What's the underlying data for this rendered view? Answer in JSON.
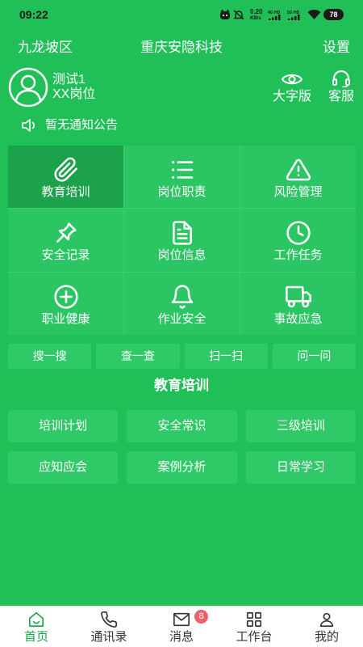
{
  "status_bar": {
    "time": "09:22",
    "net_speed": "0.20",
    "net_unit": "KB/s",
    "net_4g": "4G HD",
    "net_5g": "5G HD",
    "battery": "78"
  },
  "header": {
    "district": "九龙坡区",
    "company": "重庆安隐科技",
    "settings": "设置"
  },
  "user": {
    "name": "测试1",
    "position": "XX岗位"
  },
  "header_actions": {
    "large_font": "大字版",
    "service": "客服"
  },
  "notice": {
    "text": "暂无通知公告"
  },
  "grid": [
    {
      "label": "教育培训",
      "icon": "paperclip-icon",
      "selected": true
    },
    {
      "label": "岗位职责",
      "icon": "list-icon"
    },
    {
      "label": "风险管理",
      "icon": "warning-icon"
    },
    {
      "label": "安全记录",
      "icon": "pin-icon"
    },
    {
      "label": "岗位信息",
      "icon": "document-icon"
    },
    {
      "label": "工作任务",
      "icon": "clock-icon"
    },
    {
      "label": "职业健康",
      "icon": "plus-circle-icon"
    },
    {
      "label": "作业安全",
      "icon": "bell-icon"
    },
    {
      "label": "事故应急",
      "icon": "truck-icon"
    }
  ],
  "quick_actions": [
    {
      "label": "搜一搜"
    },
    {
      "label": "查一查"
    },
    {
      "label": "扫一扫"
    },
    {
      "label": "问一问"
    }
  ],
  "section": {
    "title": "教育培训",
    "items": [
      {
        "label": "培训计划"
      },
      {
        "label": "安全常识"
      },
      {
        "label": "三级培训"
      },
      {
        "label": "应知应会"
      },
      {
        "label": "案例分析"
      },
      {
        "label": "日常学习"
      }
    ]
  },
  "bottom_nav": [
    {
      "label": "首页",
      "icon": "home-icon",
      "active": true
    },
    {
      "label": "通讯录",
      "icon": "phone-icon"
    },
    {
      "label": "消息",
      "icon": "mail-icon",
      "badge": "8"
    },
    {
      "label": "工作台",
      "icon": "grid-icon"
    },
    {
      "label": "我的",
      "icon": "person-icon"
    }
  ],
  "colors": {
    "page_bg": "#21bf58",
    "cell_bg": "#2bc663",
    "cell_selected_bg": "#1ca24b",
    "button_bg": "#30c968",
    "nav_active": "#17a546",
    "badge_bg": "#f0606b"
  }
}
